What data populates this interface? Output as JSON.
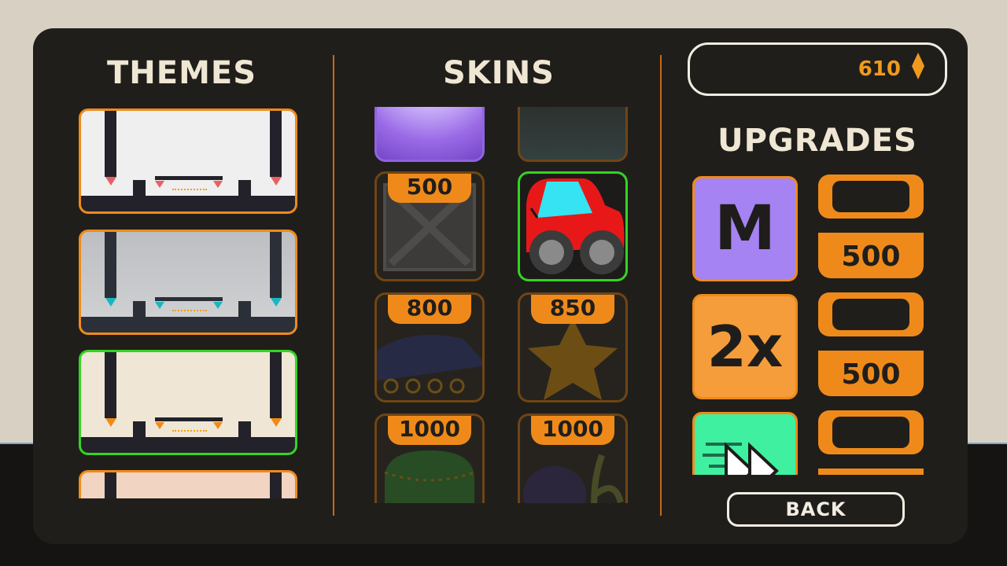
{
  "headers": {
    "themes": "THEMES",
    "skins": "SKINS",
    "upgrades": "UPGRADES"
  },
  "currency": {
    "amount": "610",
    "icon": "diamond-currency-icon"
  },
  "themes": [
    {
      "name": "white-theme",
      "bg": "#efefef",
      "accent": "#e86064",
      "selected": false
    },
    {
      "name": "grey-theme",
      "bg": "#c6c7c9",
      "accent": "#18b7c2",
      "selected": false
    },
    {
      "name": "cream-theme",
      "bg": "#efe6d6",
      "accent": "#f08a15",
      "selected": true
    },
    {
      "name": "peach-theme",
      "bg": "#f1d4c1",
      "accent": "#e86064",
      "selected": false
    }
  ],
  "skins": [
    {
      "name": "purple-glow-skin",
      "price": "",
      "locked": false
    },
    {
      "name": "dark-teal-skin",
      "price": "",
      "locked": false
    },
    {
      "name": "crate-skin",
      "price": "500",
      "locked": true
    },
    {
      "name": "red-car-skin",
      "price": "",
      "locked": false,
      "selected": true
    },
    {
      "name": "tank-skin",
      "price": "800",
      "locked": true
    },
    {
      "name": "star-skin",
      "price": "850",
      "locked": true
    },
    {
      "name": "pot-skin",
      "price": "1000",
      "locked": true
    },
    {
      "name": "plant-skin",
      "price": "1000",
      "locked": true
    }
  ],
  "upgrades": [
    {
      "label": "M",
      "color": "#a583f2",
      "price": "500"
    },
    {
      "label": "2x",
      "color": "#f59d3a",
      "price": "500"
    },
    {
      "label": "",
      "icon": "fast-forward-icon",
      "color": "#3ff0a0",
      "price": ""
    }
  ],
  "back_label": "BACK"
}
